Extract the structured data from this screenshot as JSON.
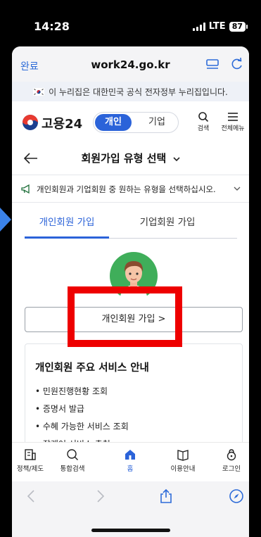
{
  "status_bar": {
    "time": "14:28",
    "network": "LTE",
    "battery": "87"
  },
  "browser": {
    "done_label": "완료",
    "url": "work24.go.kr"
  },
  "gov_banner": {
    "text": "이 누리집은 대한민국 공식 전자정부 누리집입니다."
  },
  "site_header": {
    "logo_text": "고용24",
    "toggle_personal": "개인",
    "toggle_business": "기업",
    "search_label": "검색",
    "menu_label": "전체메뉴"
  },
  "page": {
    "title": "회원가입 유형 선택",
    "notice": "개인회원과 기업회원 중 원하는 유형을 선택하십시오."
  },
  "tabs": [
    {
      "label": "개인회원 가입",
      "active": true
    },
    {
      "label": "기업회원 가입",
      "active": false
    }
  ],
  "join_button_label": "개인회원 가입 >",
  "services": {
    "title": "개인회원 주요 서비스 안내",
    "items": [
      "• 민원진행현황 조회",
      "• 증명서 발급",
      "• 수혜 가능한 서비스 조회",
      "• 잡케어 서비스 추천"
    ]
  },
  "bottom_tabs": [
    {
      "label": "정책/제도",
      "icon": "policy-icon"
    },
    {
      "label": "통합검색",
      "icon": "search-icon"
    },
    {
      "label": "홈",
      "icon": "home-icon"
    },
    {
      "label": "이용안내",
      "icon": "guide-book-icon"
    },
    {
      "label": "로그인",
      "icon": "login-lock-icon"
    }
  ],
  "colors": {
    "accent": "#2b63d9",
    "highlight": "#ee0000",
    "browser_link": "#2d6bd8"
  }
}
